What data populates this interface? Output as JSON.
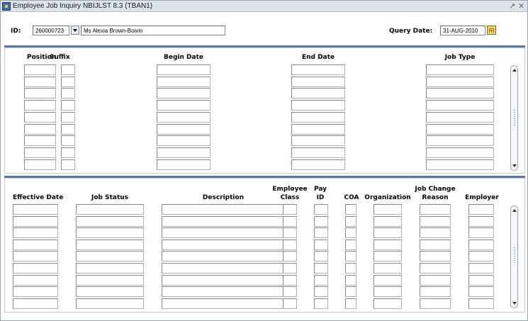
{
  "window": {
    "title": "Employee Job Inquiry  NBIJLST  8.3  (TBAN1)",
    "min_icon": "minimize-icon",
    "close_icon": "close-icon"
  },
  "key_block": {
    "id_label": "ID:",
    "id_value": "260000723",
    "name_value": "Ms Alexia Brown-Boivin",
    "query_date_label": "Query Date:",
    "query_date_value": "31-AUG-2010"
  },
  "jobs_block": {
    "headers": {
      "position": "Position",
      "suffix": "Suffix",
      "begin_date": "Begin Date",
      "end_date": "End Date",
      "job_type": "Job Type"
    }
  },
  "details_block": {
    "headers": {
      "effective_date": "Effective Date",
      "job_status": "Job Status",
      "description": "Description",
      "employee_class_1": "Employee",
      "employee_class_2": "Class",
      "pay_id_1": "Pay",
      "pay_id_2": "ID",
      "coa": "COA",
      "organization": "Organization",
      "job_change_reason_1": "Job Change",
      "job_change_reason_2": "Reason",
      "employer": "Employer"
    }
  },
  "colors": {
    "separator": "#5d7a9a",
    "title_bar": "#dde3ea",
    "calendar_button": "#f3d36b"
  }
}
